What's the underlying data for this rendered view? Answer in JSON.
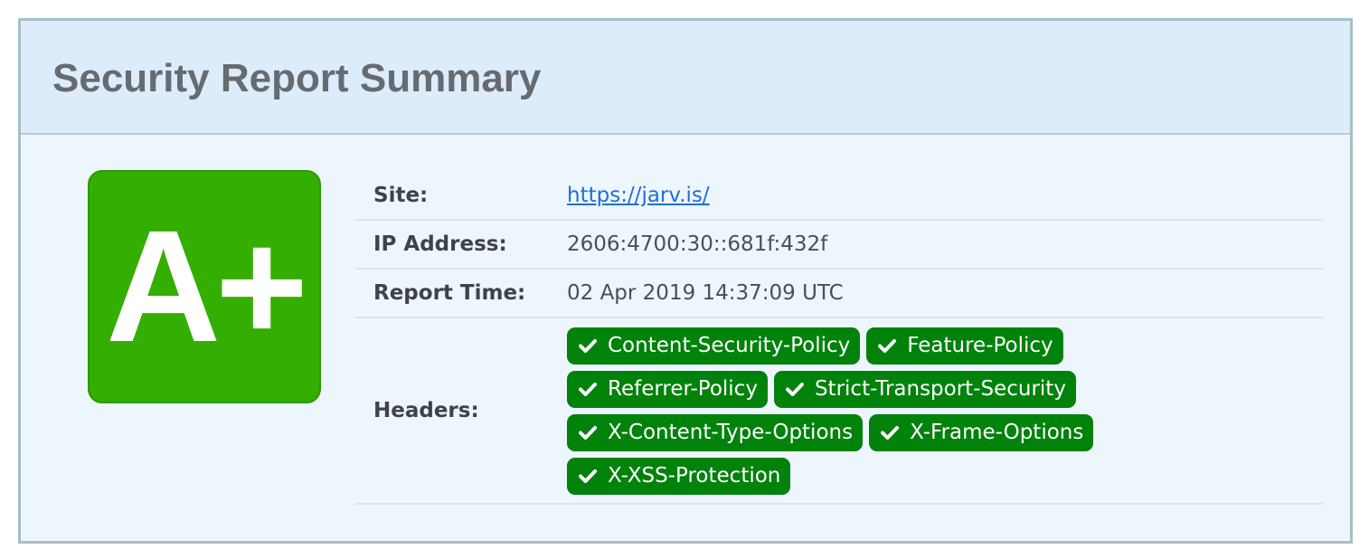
{
  "title": "Security Report Summary",
  "grade": "A+",
  "colors": {
    "grade_bg": "#34ae00",
    "badge_bg": "#00820b",
    "header_bg": "#ddecfb",
    "body_bg": "#eef6fd",
    "link": "#1f6ed8"
  },
  "rows": {
    "site": {
      "label": "Site:",
      "value": "https://jarv.is/"
    },
    "ip": {
      "label": "IP Address:",
      "value": "2606:4700:30::681f:432f"
    },
    "time": {
      "label": "Report Time:",
      "value": "02 Apr 2019 14:37:09 UTC"
    },
    "headers": {
      "label": "Headers:",
      "icon": "check-icon",
      "items": [
        "Content-Security-Policy",
        "Feature-Policy",
        "Referrer-Policy",
        "Strict-Transport-Security",
        "X-Content-Type-Options",
        "X-Frame-Options",
        "X-XSS-Protection"
      ]
    }
  }
}
